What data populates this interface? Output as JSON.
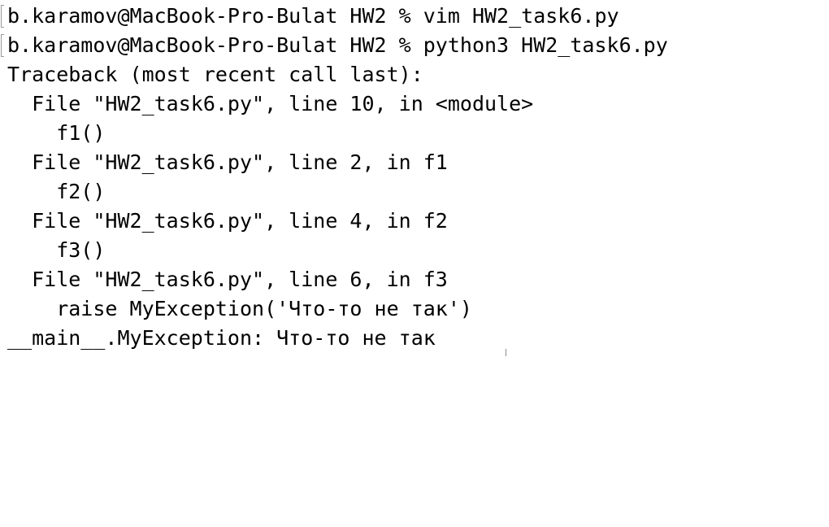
{
  "terminal": {
    "lines": [
      "b.karamov@MacBook-Pro-Bulat HW2 % vim HW2_task6.py",
      "b.karamov@MacBook-Pro-Bulat HW2 % python3 HW2_task6.py",
      "Traceback (most recent call last):",
      "  File \"HW2_task6.py\", line 10, in <module>",
      "    f1()",
      "  File \"HW2_task6.py\", line 2, in f1",
      "    f2()",
      "  File \"HW2_task6.py\", line 4, in f2",
      "    f3()",
      "  File \"HW2_task6.py\", line 6, in f3",
      "    raise MyException('Что-то не так')",
      "__main__.MyException: Что-то не так"
    ]
  }
}
